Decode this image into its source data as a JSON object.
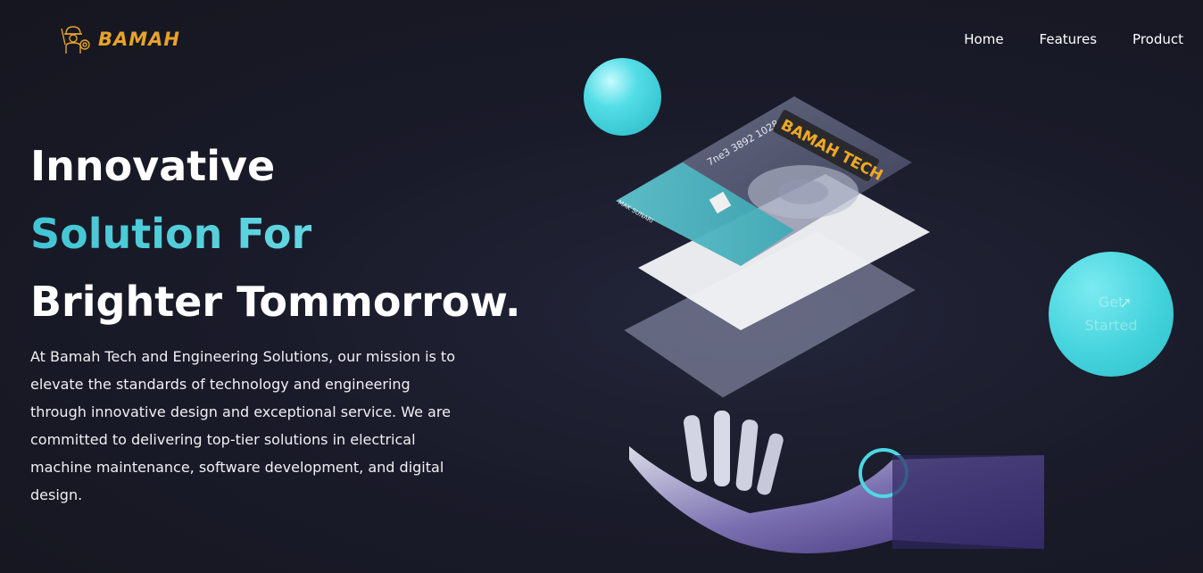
{
  "brand": {
    "name": "BAMAH",
    "accent": "#e7a32a"
  },
  "nav": {
    "items": [
      "Home",
      "Features",
      "Product"
    ]
  },
  "hero": {
    "line1": "Innovative",
    "line2": "Solution For",
    "line3": "Brighter Tommorrow.",
    "description": "At Bamah Tech and Engineering Solutions, our mission is to elevate the standards of technology and engineering through innovative design and exceptional service. We are committed to delivering top-tier solutions in electrical machine maintenance, software development, and digital design."
  },
  "illustration": {
    "card_badge": "BAMAH TECH",
    "card_number": "7ne3 3892 1028",
    "card_holder": "MAK SUNARI"
  },
  "cta": {
    "label": "Get Started",
    "icon": "arrow-up-right-icon"
  },
  "colors": {
    "background": "#1a1b2a",
    "accent_teal": "#44d3dc",
    "brand_gold": "#e7a32a"
  }
}
